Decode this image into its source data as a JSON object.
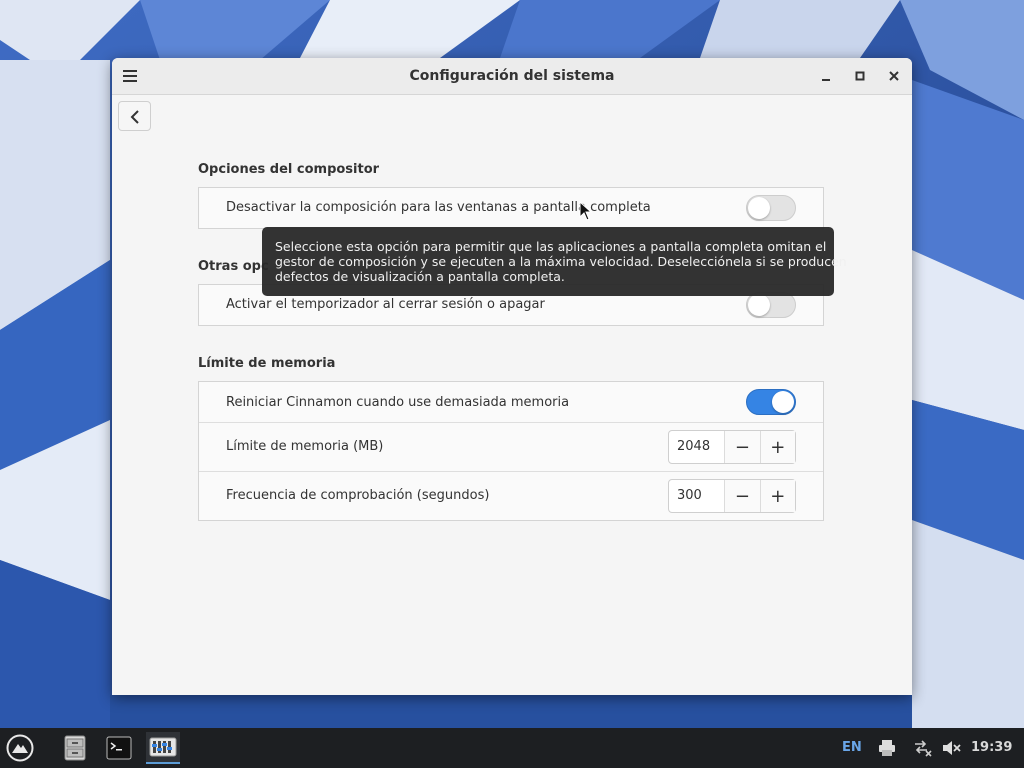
{
  "window": {
    "title": "Configuración del sistema"
  },
  "sections": {
    "compositor": {
      "title": "Opciones del compositor",
      "rows": [
        {
          "label": "Desactivar la composición para las ventanas a pantalla completa",
          "switch_on": false
        }
      ]
    },
    "other": {
      "title": "Otras opc",
      "rows": [
        {
          "label": "Activar el temporizador al cerrar sesión o apagar",
          "switch_on": false
        }
      ]
    },
    "memory": {
      "title": "Límite de memoria",
      "restart_label": "Reiniciar Cinnamon cuando use demasiada memoria",
      "restart_on": true,
      "limit_label": "Límite de memoria (MB)",
      "limit_value": "2048",
      "interval_label": "Frecuencia de comprobación (segundos)",
      "interval_value": "300",
      "minus_glyph": "−",
      "plus_glyph": "+"
    }
  },
  "tooltip": {
    "lines": [
      "Seleccione esta opción para permitir que las aplicaciones a pantalla completa omitan el",
      "gestor de composición y se ejecuten a la máxima velocidad. Deselecciónela si se producen",
      "defectos de visualización a pantalla completa."
    ]
  },
  "panel": {
    "keyboard_layout": "EN",
    "clock": "19:39",
    "launchers": [
      "file-cabinet-icon",
      "terminal-icon",
      "system-settings-icon"
    ]
  },
  "colors": {
    "accent": "#3584e4",
    "panel_bg": "#1d1f22",
    "window_bg": "#f5f5f5"
  }
}
